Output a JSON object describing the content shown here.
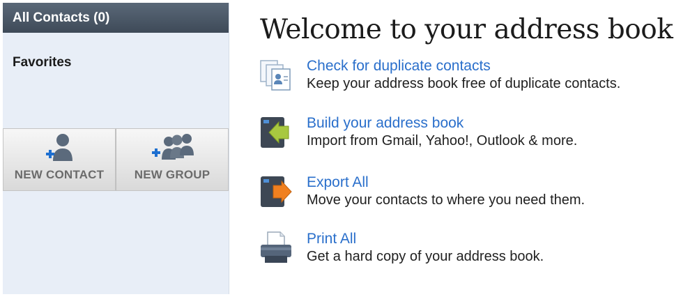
{
  "sidebar": {
    "all_contacts_label": "All Contacts (0)",
    "favorites_label": "Favorites",
    "new_contact_label": "NEW CONTACT",
    "new_group_label": "NEW GROUP"
  },
  "main": {
    "title": "Welcome to your address book",
    "features": [
      {
        "link": "Check for duplicate contacts",
        "desc": "Keep your address book free of duplicate contacts.",
        "icon": "duplicate-contacts-icon"
      },
      {
        "link": "Build your address book",
        "desc": "Import from Gmail, Yahoo!, Outlook & more.",
        "icon": "import-icon"
      },
      {
        "link": "Export All",
        "desc": "Move your contacts to where you need them.",
        "icon": "export-icon"
      },
      {
        "link": "Print All",
        "desc": "Get a hard copy of your address book.",
        "icon": "printer-icon"
      }
    ]
  },
  "colors": {
    "link": "#2a6fcb",
    "sidebar_bg": "#e8eef7",
    "header_bg": "#4a5665",
    "import_arrow": "#a8c840",
    "export_arrow": "#f08020"
  }
}
